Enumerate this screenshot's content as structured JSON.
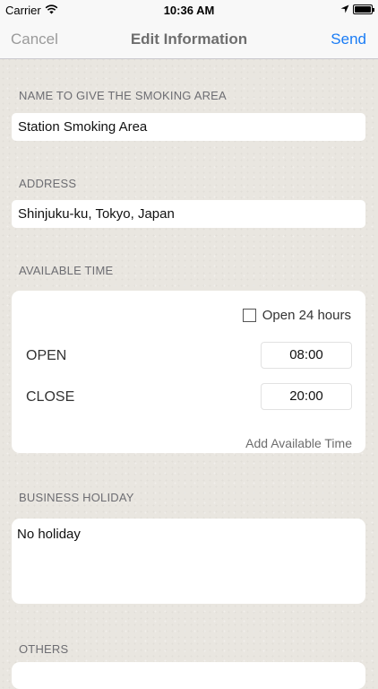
{
  "status_bar": {
    "carrier": "Carrier",
    "time": "10:36 AM"
  },
  "nav": {
    "cancel": "Cancel",
    "title": "Edit Information",
    "send": "Send"
  },
  "sections": {
    "name_header": "NAME TO GIVE THE SMOKING AREA",
    "name_value": "Station Smoking Area",
    "address_header": "ADDRESS",
    "address_value": "Shinjuku-ku, Tokyo, Japan",
    "time_header": "AVAILABLE TIME",
    "open24_label": "Open 24 hours",
    "open24_checked": false,
    "open_label": "OPEN",
    "open_value": "08:00",
    "close_label": "CLOSE",
    "close_value": "20:00",
    "add_time": "Add Available Time",
    "holiday_header": "BUSINESS HOLIDAY",
    "holiday_value": "No holiday",
    "others_header": "OTHERS"
  }
}
